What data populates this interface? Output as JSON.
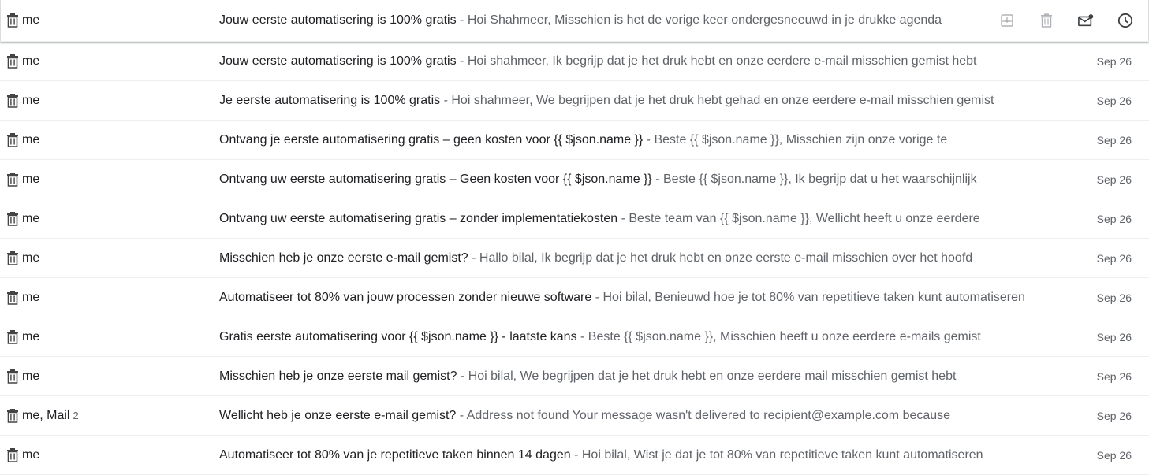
{
  "emails": [
    {
      "sender": "me",
      "count": "",
      "subject": "Jouw eerste automatisering is 100% gratis",
      "snippet": "Hoi Shahmeer, Misschien is het de vorige keer ondergesneeuwd in je drukke agenda",
      "date": "",
      "hovered": true
    },
    {
      "sender": "me",
      "count": "",
      "subject": "Jouw eerste automatisering is 100% gratis",
      "snippet": "Hoi shahmeer, Ik begrijp dat je het druk hebt en onze eerdere e-mail misschien gemist hebt",
      "date": "Sep 26"
    },
    {
      "sender": "me",
      "count": "",
      "subject": "Je eerste automatisering is 100% gratis",
      "snippet": "Hoi shahmeer, We begrijpen dat je het druk hebt gehad en onze eerdere e-mail misschien gemist",
      "date": "Sep 26"
    },
    {
      "sender": "me",
      "count": "",
      "subject": "Ontvang je eerste automatisering gratis – geen kosten voor {{ $json.name }}",
      "snippet": "Beste {{ $json.name }}, Misschien zijn onze vorige te",
      "date": "Sep 26"
    },
    {
      "sender": "me",
      "count": "",
      "subject": "Ontvang uw eerste automatisering gratis – Geen kosten voor {{ $json.name }}",
      "snippet": "Beste {{ $json.name }}, Ik begrijp dat u het waarschijnlijk",
      "date": "Sep 26"
    },
    {
      "sender": "me",
      "count": "",
      "subject": "Ontvang uw eerste automatisering gratis – zonder implementatiekosten",
      "snippet": "Beste team van {{ $json.name }}, Wellicht heeft u onze eerdere",
      "date": "Sep 26"
    },
    {
      "sender": "me",
      "count": "",
      "subject": "Misschien heb je onze eerste e-mail gemist?",
      "snippet": "Hallo bilal, Ik begrijp dat je het druk hebt en onze eerste e-mail misschien over het hoofd",
      "date": "Sep 26"
    },
    {
      "sender": "me",
      "count": "",
      "subject": "Automatiseer tot 80% van jouw processen zonder nieuwe software",
      "snippet": "Hoi bilal, Benieuwd hoe je tot 80% van repetitieve taken kunt automatiseren",
      "date": "Sep 26"
    },
    {
      "sender": "me",
      "count": "",
      "subject": "Gratis eerste automatisering voor {{ $json.name }} - laatste kans",
      "snippet": "Beste {{ $json.name }}, Misschien heeft u onze eerdere e-mails gemist",
      "date": "Sep 26"
    },
    {
      "sender": "me",
      "count": "",
      "subject": "Misschien heb je onze eerste mail gemist?",
      "snippet": "Hoi bilal, We begrijpen dat je het druk hebt en onze eerdere mail misschien gemist hebt",
      "date": "Sep 26"
    },
    {
      "sender": "me, Mail",
      "count": "2",
      "subject": "Wellicht heb je onze eerste e-mail gemist?",
      "snippet": "Address not found Your message wasn't delivered to recipient@example.com because",
      "date": "Sep 26"
    },
    {
      "sender": "me",
      "count": "",
      "subject": "Automatiseer tot 80% van je repetitieve taken binnen 14 dagen",
      "snippet": "Hoi bilal, Wist je dat je tot 80% van repetitieve taken kunt automatiseren",
      "date": "Sep 26"
    }
  ],
  "hover_actions": [
    "archive-icon",
    "delete-icon",
    "mark-unread-icon",
    "snooze-icon"
  ],
  "row_icon": "trash-icon",
  "colors": {
    "subject": "#202124",
    "snippet": "#5f6368",
    "divider": "#eceff1"
  }
}
